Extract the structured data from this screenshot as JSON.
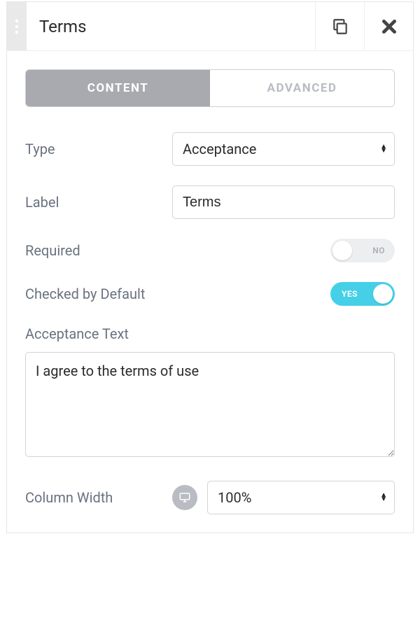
{
  "header": {
    "title": "Terms"
  },
  "tabs": {
    "content": "CONTENT",
    "advanced": "ADVANCED"
  },
  "fields": {
    "type_label": "Type",
    "type_value": "Acceptance",
    "label_label": "Label",
    "label_value": "Terms",
    "required_label": "Required",
    "required_state": "NO",
    "checked_default_label": "Checked by Default",
    "checked_default_state": "YES",
    "acceptance_text_label": "Acceptance Text",
    "acceptance_text_value": "I agree to the terms of use",
    "column_width_label": "Column Width",
    "column_width_value": "100%"
  }
}
